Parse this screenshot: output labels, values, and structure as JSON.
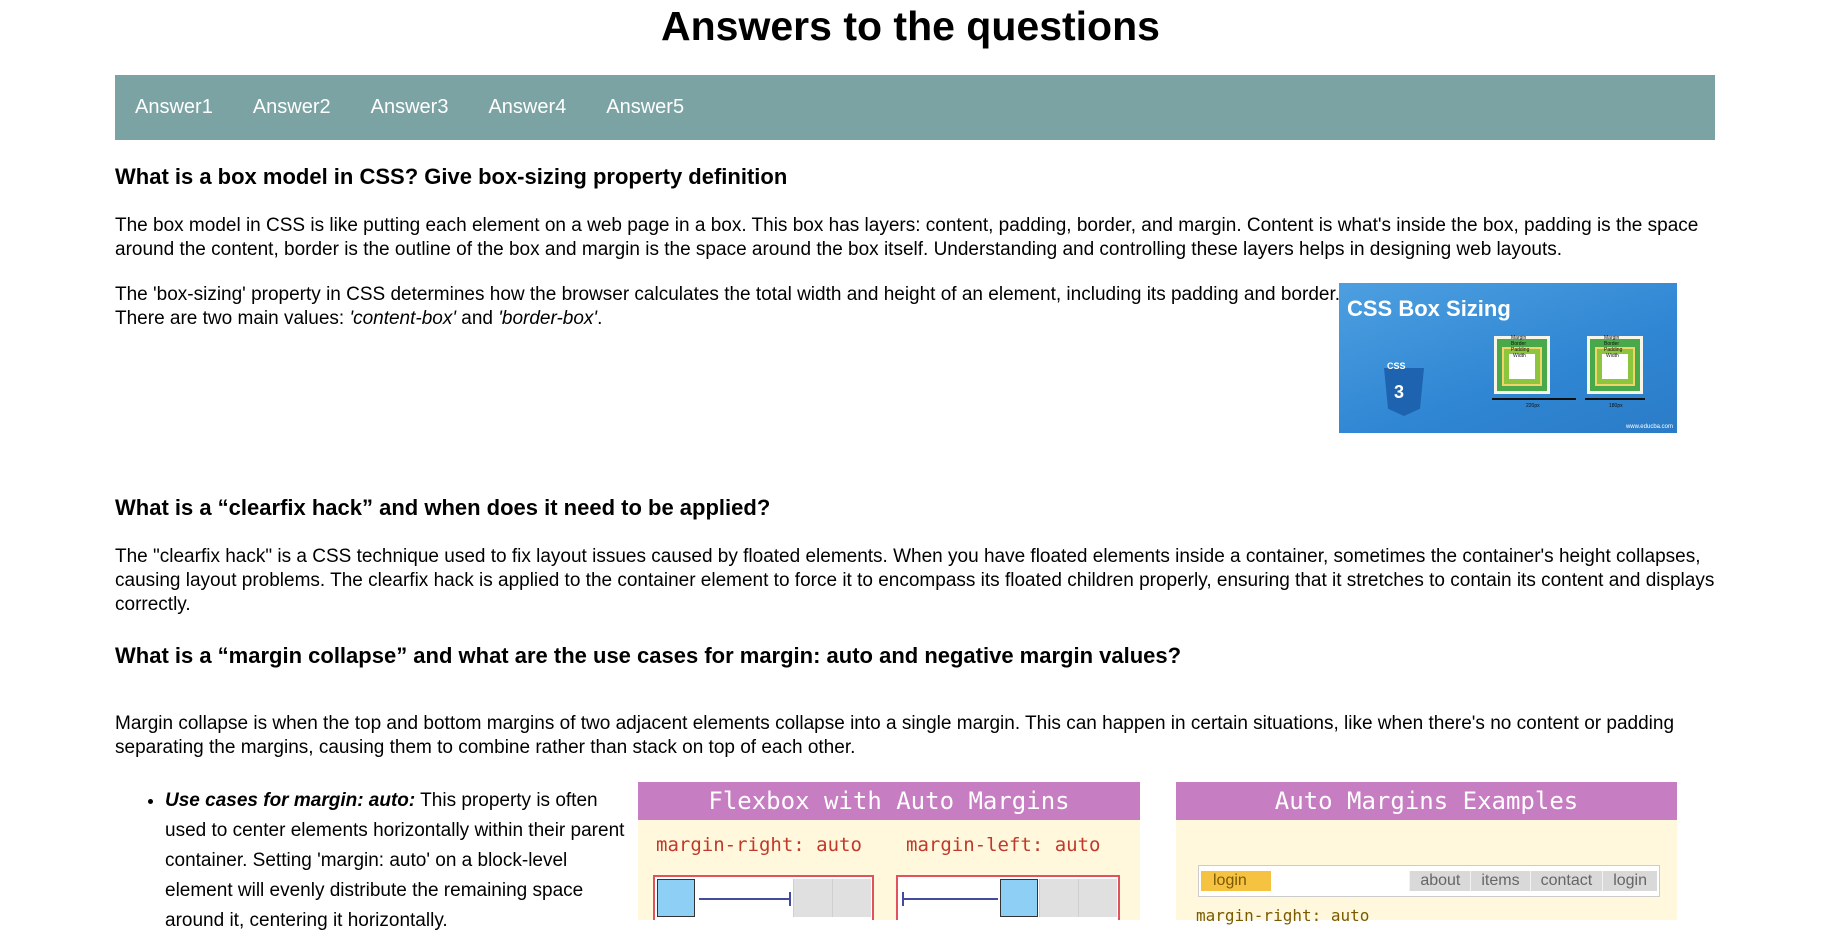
{
  "header": {
    "title": "Answers to the questions"
  },
  "nav": {
    "items": [
      "Answer1",
      "Answer2",
      "Answer3",
      "Answer4",
      "Answer5"
    ]
  },
  "q1": {
    "heading": "What is a box model in CSS? Give box-sizing property definition",
    "p1": "The box model in CSS is like putting each element on a web page in a box. This box has layers: content, padding, border, and margin. Content is what's inside the box, padding is the space around the content, border is the outline of the box and margin is the space around the box itself. Understanding and controlling these layers helps in designing web layouts.",
    "p2_a": "The 'box-sizing' property in CSS determines how the browser calculates the total width and height of an element, including its padding and border. There are two main values: ",
    "p2_content_box": "'content-box'",
    "p2_and": " and ",
    "p2_border_box": "'border-box'",
    "p2_end": ".",
    "image": {
      "title": "CSS Box Sizing",
      "css_tag": "CSS",
      "shield_digit": "3",
      "labels": [
        "Margin",
        "Border",
        "Padding",
        "Width"
      ],
      "widths": [
        "220px",
        "180px"
      ],
      "credit": "www.educba.com"
    }
  },
  "q2": {
    "heading": "What is a “clearfix hack” and when does it need to be applied?",
    "p1": "The \"clearfix hack\" is a CSS technique used to fix layout issues caused by floated elements. When you have floated elements inside a container, sometimes the container's height collapses, causing layout problems. The clearfix hack is applied to the container element to force it to encompass its floated children properly, ensuring that it stretches to contain its content and displays correctly."
  },
  "q3": {
    "heading": "What is a “margin collapse” and what are the use cases for margin: auto and negative margin values?",
    "p1": "Margin collapse is when the top and bottom margins of two adjacent elements collapse into a single margin. This can happen in certain situations, like when there's no content or padding separating the margins, causing them to combine rather than stack on top of each other.",
    "case1_label": "Use cases for margin: auto:",
    "case1_text": " This property is often used to center elements horizontally within their parent container. Setting 'margin: auto' on a block-level element will evenly distribute the remaining space around it, centering it horizontally.",
    "flex_image": {
      "title": "Flexbox with Auto Margins",
      "left_label": "margin-right: auto",
      "right_label": "margin-left: auto"
    },
    "auto_image": {
      "title": "Auto Margins Examples",
      "menu_left": "login",
      "menu_right": [
        "about",
        "items",
        "contact",
        "login"
      ],
      "bottom_label": "margin-right: auto"
    }
  },
  "colors": {
    "nav_bg": "#7ba3a3",
    "card_header": "#c77dc1",
    "card_bg": "#fff8dc"
  }
}
